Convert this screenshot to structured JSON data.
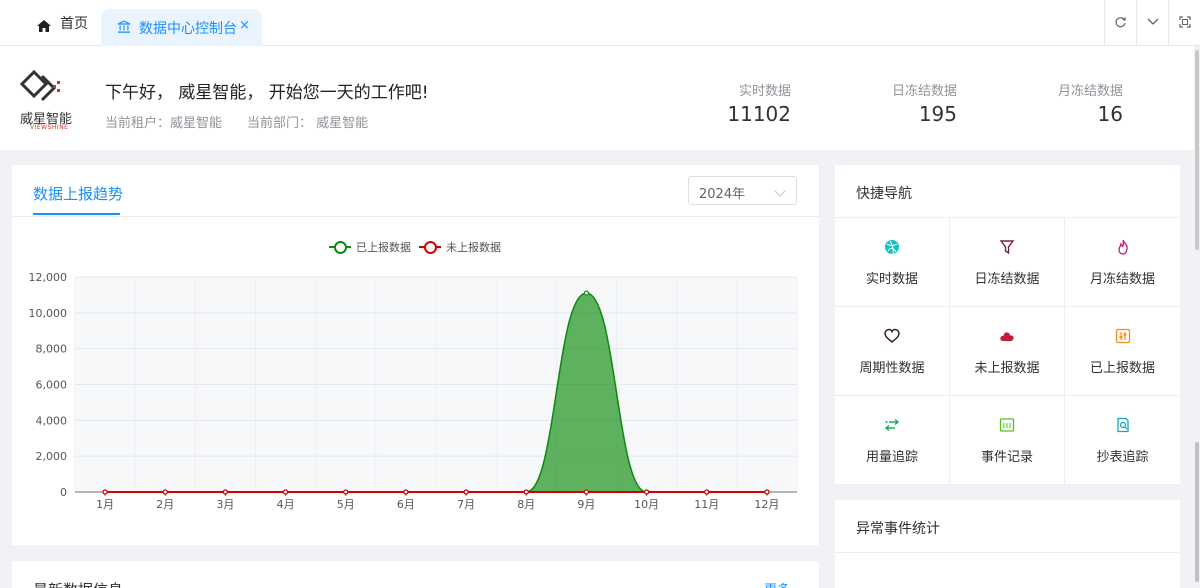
{
  "tabs": {
    "home_label": "首页",
    "active_label": "数据中心控制台",
    "close_symbol": "×"
  },
  "toolbar": {
    "refresh_icon": "refresh-icon",
    "dropdown_icon": "chevron-down-icon",
    "fullscreen_icon": "fullscreen-icon"
  },
  "header": {
    "logo_text": "威星智能",
    "logo_sub": "VIEWSHINE",
    "greeting": "下午好， 威星智能， 开始您一天的工作吧!",
    "tenant": "当前租户：威星智能",
    "department": "当前部门： 威星智能",
    "stats": [
      {
        "label": "实时数据",
        "value": "11102"
      },
      {
        "label": "日冻结数据",
        "value": "195"
      },
      {
        "label": "月冻结数据",
        "value": "16"
      }
    ]
  },
  "trend": {
    "tab_label": "数据上报趋势",
    "year": "2024年"
  },
  "chart_data": {
    "type": "area",
    "categories": [
      "1月",
      "2月",
      "3月",
      "4月",
      "5月",
      "6月",
      "7月",
      "8月",
      "9月",
      "10月",
      "11月",
      "12月"
    ],
    "series": [
      {
        "name": "已上报数据",
        "color": "#0c8a0c",
        "values": [
          0,
          0,
          0,
          0,
          0,
          0,
          0,
          0,
          11102,
          0,
          0,
          0
        ]
      },
      {
        "name": "未上报数据",
        "color": "#d40000",
        "values": [
          0,
          0,
          0,
          0,
          0,
          0,
          0,
          0,
          0,
          0,
          0,
          0
        ]
      }
    ],
    "ylim": [
      0,
      12000
    ],
    "yticks": [
      "0",
      "2,000",
      "4,000",
      "6,000",
      "8,000",
      "10,000",
      "12,000"
    ],
    "legend": "top-center",
    "grid": true
  },
  "quick_nav": {
    "title": "快捷导航",
    "items": [
      {
        "label": "实时数据",
        "icon": "dribbble-icon",
        "color": "#13c2c2"
      },
      {
        "label": "日冻结数据",
        "icon": "filter-icon",
        "color": "#7a1f45"
      },
      {
        "label": "月冻结数据",
        "icon": "flame-icon",
        "color": "#c41d7f"
      },
      {
        "label": "周期性数据",
        "icon": "heart-icon",
        "color": "#3a1a3a"
      },
      {
        "label": "未上报数据",
        "icon": "cloud-icon",
        "color": "#c41d2f"
      },
      {
        "label": "已上报数据",
        "icon": "sliders-icon",
        "color": "#fa8c16"
      },
      {
        "label": "用量追踪",
        "icon": "exchange-icon",
        "color": "#1aad5a"
      },
      {
        "label": "事件记录",
        "icon": "calendar-icon",
        "color": "#52c41a"
      },
      {
        "label": "抄表追踪",
        "icon": "document-search-icon",
        "color": "#13a8c2"
      }
    ]
  },
  "abnormal": {
    "title": "异常事件统计"
  },
  "latest": {
    "title": "最新数据信息",
    "more": "更多"
  }
}
